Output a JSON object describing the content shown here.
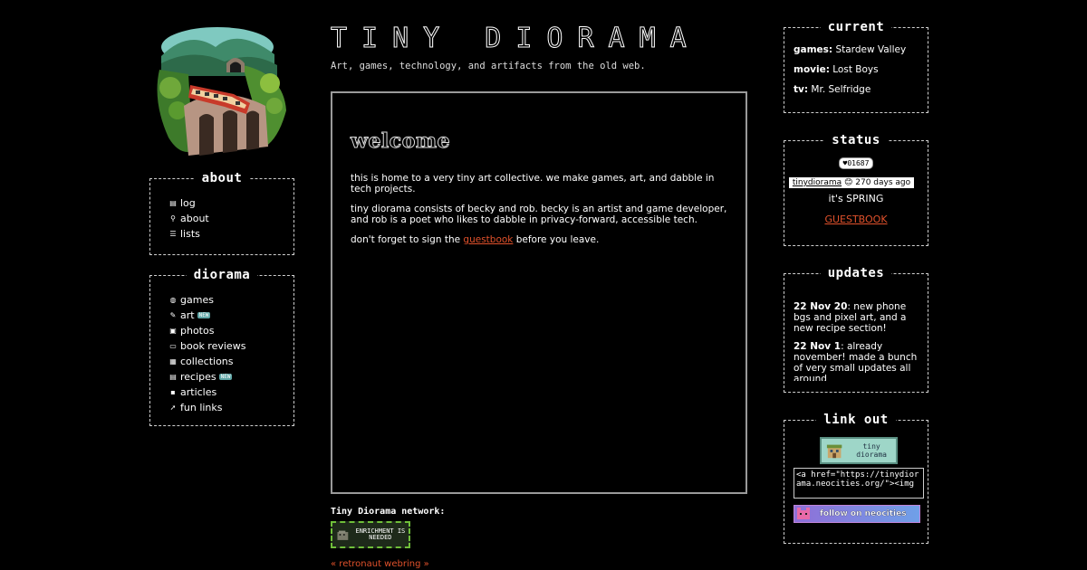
{
  "site": {
    "title": "TINY DIORAMA",
    "tagline": "Art, games, technology, and artifacts from the old web."
  },
  "about": {
    "heading": "about",
    "items": [
      {
        "label": "log",
        "icon": "notebook-icon"
      },
      {
        "label": "about",
        "icon": "magnifier-icon"
      },
      {
        "label": "lists",
        "icon": "list-icon"
      }
    ]
  },
  "diorama": {
    "heading": "diorama",
    "items": [
      {
        "label": "games",
        "icon": "gamepad-icon",
        "badge": ""
      },
      {
        "label": "art",
        "icon": "pencil-icon",
        "badge": "NEW"
      },
      {
        "label": "photos",
        "icon": "photo-icon",
        "badge": ""
      },
      {
        "label": "book reviews",
        "icon": "book-icon",
        "badge": ""
      },
      {
        "label": "collections",
        "icon": "box-icon",
        "badge": ""
      },
      {
        "label": "recipes",
        "icon": "recipe-icon",
        "badge": "NEW"
      },
      {
        "label": "articles",
        "icon": "save-icon",
        "badge": ""
      },
      {
        "label": "fun links",
        "icon": "arrow-icon",
        "badge": ""
      }
    ]
  },
  "welcome": {
    "heading": "welcome",
    "p1": "this is home to a very tiny art collective. we make games, art, and dabble in tech projects.",
    "p2": "tiny diorama consists of becky and rob. becky is an artist and game developer, and rob is a poet who likes to dabble in privacy-forward, accessible tech.",
    "p3_before": "don't forget to sign the ",
    "p3_link": "guestbook",
    "p3_after": " before you leave."
  },
  "network": {
    "label": "Tiny Diorama network:",
    "button_text": "ENRICHMENT IS NEEDED",
    "webring": "« retronaut webring »"
  },
  "current": {
    "heading": "current",
    "games_key": "games:",
    "games_val": "Stardew Valley",
    "movie_key": "movie:",
    "movie_val": "Lost Boys",
    "tv_key": "tv:",
    "tv_val": "Mr. Selfridge"
  },
  "status": {
    "heading": "status",
    "counter": "01687",
    "user": "tinydiorama",
    "emoji": "😊",
    "ago": "270 days ago",
    "message": "it's SPRING",
    "guestbook": "GUESTBOOK"
  },
  "updates": {
    "heading": "updates",
    "entries": [
      {
        "date": "22 Nov 20",
        "text": ": new phone bgs and pixel art, and a new recipe section!"
      },
      {
        "date": "22 Nov 1",
        "text": ": already november! made a bunch of very small updates all around"
      }
    ]
  },
  "linkout": {
    "heading": "link out",
    "banner_text": "tiny diorama",
    "code": "<a href=\"https://tinydiorama.neocities.org/\"><img",
    "follow": "follow on neocities"
  },
  "colors": {
    "accent": "#e0512b",
    "border": "#d0d0d0",
    "badge": "#5fa6a6"
  }
}
